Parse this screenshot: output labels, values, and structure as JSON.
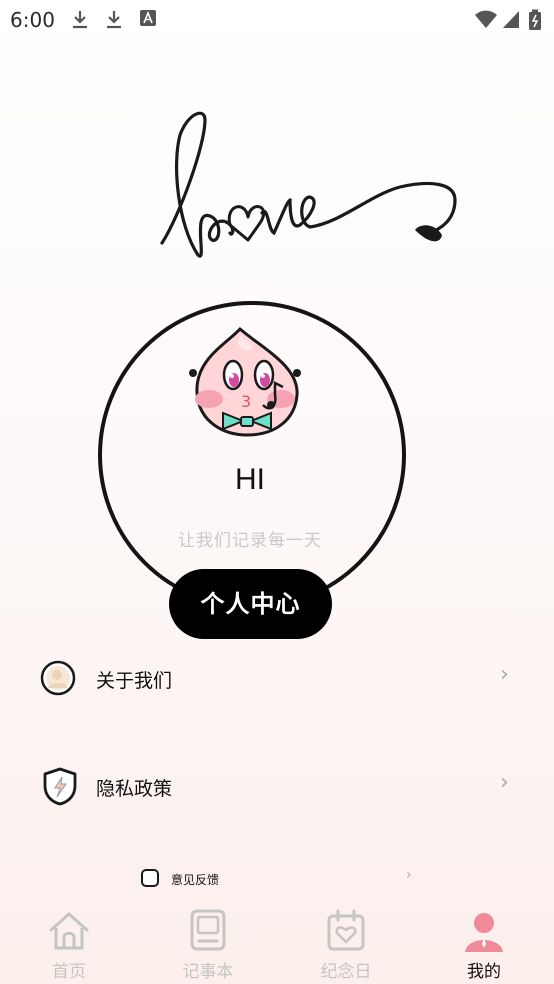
{
  "status_bar": {
    "time": "6:00"
  },
  "hero": {
    "greeting": "HI",
    "subtitle": "让我们记录每一天",
    "center_button": "个人中心"
  },
  "menu": {
    "about": "关于我们",
    "privacy": "隐私政策",
    "feedback": "意见反馈",
    "chevron": "›"
  },
  "nav": {
    "items": [
      {
        "label": "首页",
        "icon": "home-icon",
        "active": false
      },
      {
        "label": "记事本",
        "icon": "notebook-icon",
        "active": false
      },
      {
        "label": "纪念日",
        "icon": "calendar-heart-icon",
        "active": false
      },
      {
        "label": "我的",
        "icon": "person-icon",
        "active": true
      }
    ]
  },
  "colors": {
    "accent": "#f08a98",
    "inactive": "#c5c5c5",
    "button": "#000000"
  }
}
